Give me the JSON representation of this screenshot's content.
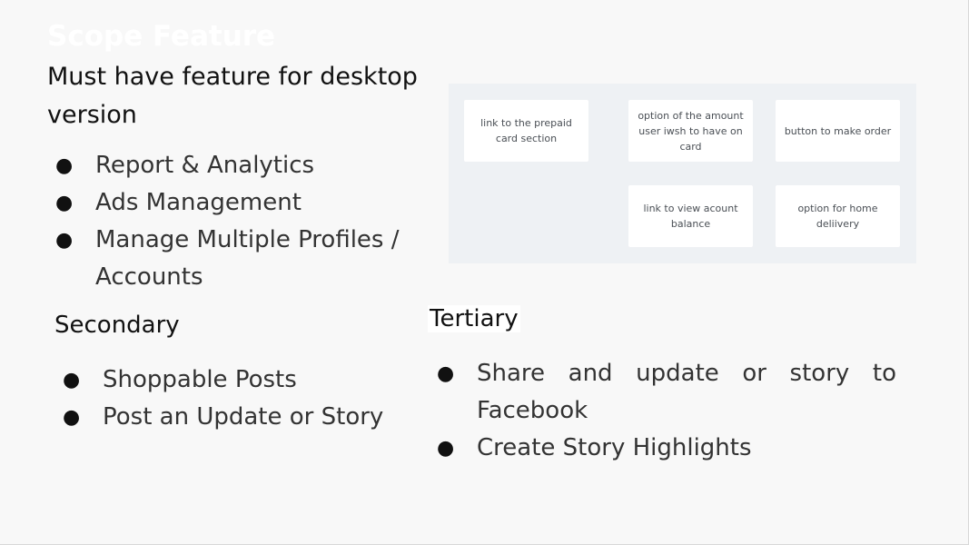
{
  "title": "Scope Feature",
  "main": {
    "heading": "Must have feature for desktop version",
    "items": [
      "Report & Analytics",
      "Ads Management",
      " Manage Multiple Profiles / Accounts"
    ]
  },
  "secondary": {
    "heading": "Secondary",
    "items": [
      " Shoppable Posts",
      "Post an Update or Story"
    ]
  },
  "tertiary": {
    "heading": "Tertiary",
    "items": [
      "Share and update or story to Facebook",
      "Create Story Highlights"
    ]
  },
  "bullet_glyph": "●",
  "wireframe": {
    "cards": [
      "link to the prepaid card section",
      "option  of the amount user iwsh to have on card",
      "button to make order",
      "link to view acount balance",
      "option for home deliivery"
    ]
  },
  "colors": {
    "background": "#f8f8f8",
    "panel": "#eef1f4",
    "card": "#ffffff"
  }
}
